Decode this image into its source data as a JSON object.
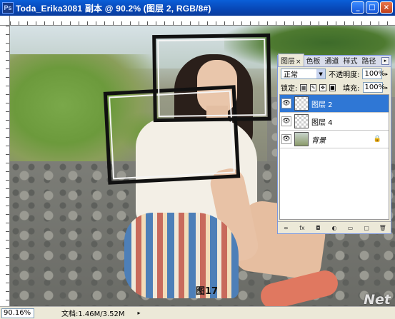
{
  "window": {
    "title": "Toda_Erika3081 副本 @ 90.2% (图层 2, RGB/8#)",
    "app_icon_text": "Ps",
    "minimize": "_",
    "maximize": "□",
    "close": "×"
  },
  "canvas": {
    "caption": "图17"
  },
  "layers_panel": {
    "tabs": [
      {
        "label": "图层",
        "active": true
      },
      {
        "label": "色板"
      },
      {
        "label": "通道"
      },
      {
        "label": "样式"
      },
      {
        "label": "路径"
      }
    ],
    "tab_close": "×",
    "blend_mode": "正常",
    "opacity_label": "不透明度:",
    "opacity_value": "100%",
    "lock_label": "锁定:",
    "fill_label": "填充:",
    "fill_value": "100%",
    "layers": [
      {
        "name": "图层 2",
        "selected": true,
        "thumb": "checker"
      },
      {
        "name": "图层 4",
        "selected": false,
        "thumb": "checker"
      },
      {
        "name": "背景",
        "selected": false,
        "thumb": "photo",
        "locked": true
      }
    ],
    "footer_icons": [
      "link-icon",
      "fx-icon",
      "mask-icon",
      "adjustment-icon",
      "folder-icon",
      "new-layer-icon",
      "trash-icon"
    ],
    "footer_glyphs": [
      "∞",
      "fx",
      "◘",
      "◐",
      "▭",
      "▢",
      "🗑"
    ]
  },
  "status": {
    "zoom": "90.16%",
    "doc_info": "文档:1.46M/3.52M"
  },
  "watermark": "Net"
}
